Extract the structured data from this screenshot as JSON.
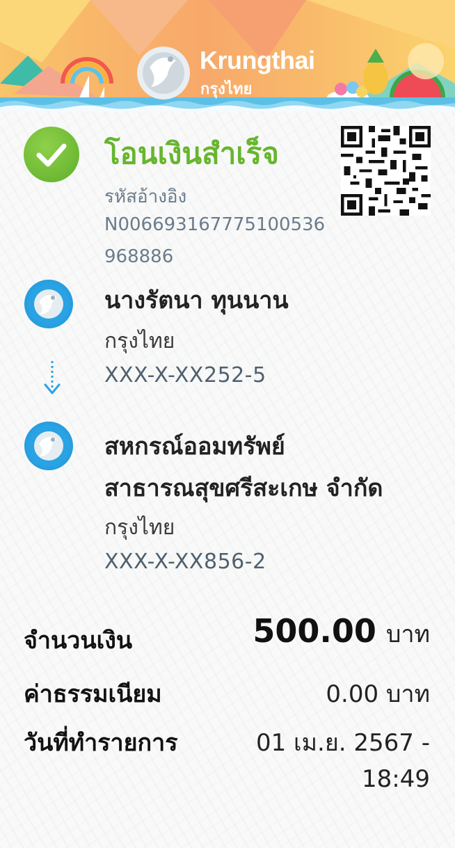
{
  "brand": {
    "name_en": "Krungthai",
    "name_th": "กรุงไทย"
  },
  "status": {
    "title": "โอนเงินสำเร็จ",
    "color": "#67b52e",
    "ref_label": "รหัสอ้างอิง",
    "ref_line1": "N006693167775100536",
    "ref_line2": "968886"
  },
  "sender": {
    "name": "นางรัตนา ทุนนาน",
    "bank": "กรุงไทย",
    "account": "XXX-X-XX252-5"
  },
  "receiver": {
    "name_line1": "สหกรณ์ออมทรัพย์",
    "name_line2": "สาธารณสุขศรีสะเกษ จำกัด",
    "bank": "กรุงไทย",
    "account": "XXX-X-XX856-2"
  },
  "summary": {
    "amount_label": "จำนวนเงิน",
    "amount_value": "500.00",
    "amount_unit": "บาท",
    "fee_label": "ค่าธรรมเนียม",
    "fee_value": "0.00 บาท",
    "date_label": "วันที่ทำรายการ",
    "date_line1": "01 เม.ย. 2567 -",
    "date_line2": "18:49"
  },
  "icons": {
    "check": "check-icon",
    "qr": "qr-code-icon",
    "bank": "krungthai-logo-icon",
    "arrow": "arrow-down-icon"
  }
}
